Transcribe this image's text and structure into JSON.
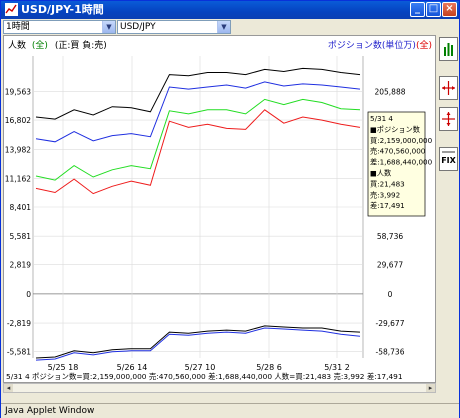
{
  "window": {
    "title": "USD/JPY-1時間"
  },
  "toolbar": {
    "period": "1時間",
    "pair": "USD/JPY"
  },
  "legend": {
    "left_prefix": "人数",
    "left_badge": "全",
    "left_suffix": "(正:買  負:売)",
    "right_prefix": "ポジション数(単位万)",
    "right_badge": "全"
  },
  "tooltip": [
    "5/31 4",
    "■ポジション数",
    "買:2,159,000,000",
    "売:470,560,000",
    "差:1,688,440,000",
    "■人数",
    "買:21,483",
    "売:3,992",
    "差:17,491"
  ],
  "axes": {
    "left_ticks": [
      "19,563",
      "16,802",
      "13,982",
      "11,162",
      "8,401",
      "5,581",
      "2,819",
      "0",
      "-2,819",
      "-5,581"
    ],
    "right_ticks": [
      "205,888",
      "176,828",
      "147,588",
      "118,178",
      "88,414",
      "58,736",
      "29,677",
      "0",
      "-29,677",
      "-58,736"
    ],
    "x_ticks": [
      "5/25 18",
      "5/26 14",
      "5/27 10",
      "5/28 6",
      "5/31 2"
    ]
  },
  "bottom_info": "5/31 4  ポジション数=買:2,159,000,000 売:470,560,000 差:1,688,440,000 人数=買:21,483 売:3,992 差:17,491",
  "status": "Java Applet Window",
  "colors": {
    "black": "#000000",
    "blue": "#1f2fe0",
    "red": "#ee1c1c",
    "green": "#22dd22",
    "legend_left": "#008000",
    "legend_right": "#2222cc",
    "badge_red": "#dd0000"
  },
  "chart_data": {
    "type": "line",
    "x": [
      "5/25 18",
      "5/26 14",
      "5/27 10",
      "5/28 6",
      "5/31 2"
    ],
    "left_axis_ticks": [
      19563,
      16802,
      13982,
      11162,
      8401,
      5581,
      2819,
      0,
      -2819,
      -5581
    ],
    "right_axis_ticks": [
      205888,
      176828,
      147588,
      118178,
      88414,
      58736,
      29677,
      0,
      -29677,
      -58736
    ],
    "series": [
      {
        "name": "ポジション数 買",
        "color": "#000000",
        "values": [
          17100,
          16900,
          17800,
          17300,
          18100,
          18000,
          17600,
          21200,
          21100,
          21400,
          21400,
          21200,
          21700,
          21500,
          21800,
          21700,
          21400,
          21200
        ]
      },
      {
        "name": "ポジション数 差",
        "color": "#1f2fe0",
        "values": [
          15000,
          14700,
          15700,
          14800,
          15300,
          15500,
          15200,
          20000,
          19800,
          20000,
          20200,
          19900,
          20500,
          20100,
          20300,
          20200,
          20000,
          19800
        ]
      },
      {
        "name": "人数 差",
        "color": "#ee1c1c",
        "values": [
          10200,
          9800,
          11100,
          9700,
          10400,
          10900,
          10500,
          16700,
          16100,
          16400,
          16000,
          15900,
          17800,
          16500,
          17100,
          16800,
          16400,
          16100
        ]
      },
      {
        "name": "人数 買",
        "color": "#22dd22",
        "values": [
          11400,
          11000,
          12400,
          11300,
          12000,
          12400,
          12100,
          17700,
          17400,
          17800,
          17800,
          17400,
          18800,
          18300,
          18800,
          18500,
          17900,
          17800
        ]
      }
    ],
    "lower_series": [
      {
        "name": "ポジション数 売",
        "color": "#000000",
        "values": [
          -6200,
          -6100,
          -5500,
          -5700,
          -5400,
          -5300,
          -5300,
          -3700,
          -3800,
          -3600,
          -3500,
          -3600,
          -3100,
          -3200,
          -3300,
          -3300,
          -3600,
          -3700
        ]
      },
      {
        "name": "人数 売",
        "color": "#1f2fe0",
        "values": [
          -6400,
          -6300,
          -5700,
          -5900,
          -5600,
          -5500,
          -5500,
          -3900,
          -4000,
          -3800,
          -3700,
          -3800,
          -3300,
          -3400,
          -3500,
          -3600,
          -3900,
          -4100
        ]
      }
    ]
  }
}
